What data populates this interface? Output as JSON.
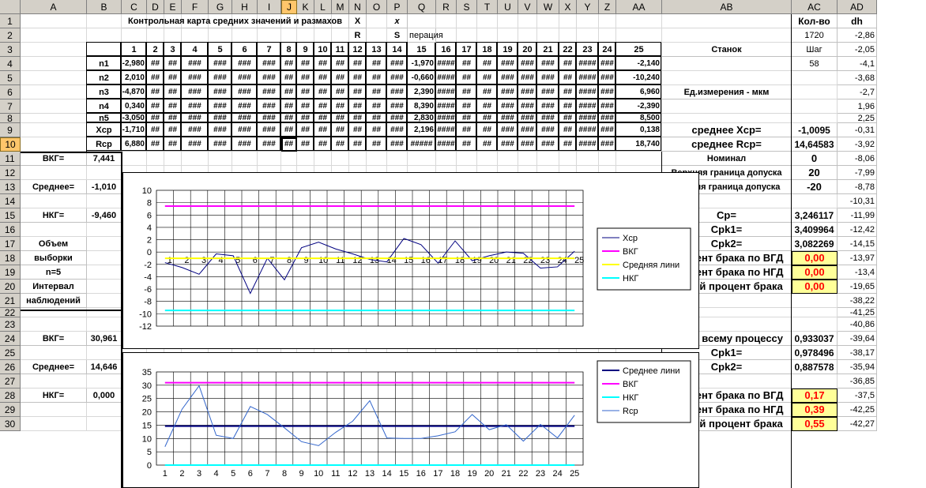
{
  "columns": [
    "A",
    "B",
    "C",
    "D",
    "E",
    "F",
    "G",
    "H",
    "I",
    "J",
    "K",
    "L",
    "M",
    "N",
    "O",
    "P",
    "Q",
    "R",
    "S",
    "T",
    "U",
    "V",
    "W",
    "X",
    "Y",
    "Z",
    "AA",
    "AB",
    "AC",
    "AD"
  ],
  "selected_column": "J",
  "rows": [
    "1",
    "2",
    "3",
    "4",
    "5",
    "6",
    "7",
    "8",
    "9",
    "10",
    "11",
    "12",
    "13",
    "14",
    "15",
    "16",
    "17",
    "18",
    "19",
    "20",
    "21",
    "22",
    "23",
    "24",
    "25",
    "26",
    "27",
    "28",
    "29",
    "30"
  ],
  "selected_row": "10",
  "title": "Контрольная карта средних значений и размахов",
  "n1": "X",
  "n2": "R",
  "p1": "x",
  "p2": "S",
  "q2": "перация",
  "ac1": "Кол-во",
  "ad1": "dh",
  "ac2": "1720",
  "ad2": "-2,86",
  "ab3": "Станок",
  "ac3": "Шаг",
  "ad3": "-2,05",
  "ac4": "58",
  "ad4": "-4,1",
  "ab6": "Ед.измерения - мкм",
  "ad_col": [
    "",
    "",
    "",
    "",
    "-3,68",
    "-2,7",
    "1,96",
    "2,25",
    "-0,31",
    "-3,92",
    "-8,06",
    "-7,99",
    "-8,78",
    "-10,31",
    "-11,99",
    "-12,42",
    "-14,15",
    "-13,97",
    "-13,4",
    "-19,65",
    "-38,22",
    "-41,25",
    "-40,86",
    "-39,64",
    "-38,17",
    "-35,94",
    "-36,85",
    "-37,5",
    "-42,25",
    "-42,27"
  ],
  "col_numbers": [
    "1",
    "2",
    "3",
    "4",
    "5",
    "6",
    "7",
    "8",
    "9",
    "10",
    "11",
    "12",
    "13",
    "14",
    "15",
    "16",
    "17",
    "18",
    "19",
    "20",
    "21",
    "22",
    "23",
    "24",
    "25"
  ],
  "row_labels": [
    "n1",
    "n2",
    "n3",
    "n4",
    "n5",
    "Xср",
    "Rср"
  ],
  "table": [
    [
      "-2,980",
      "##",
      "##",
      "###",
      "###",
      "###",
      "###",
      "##",
      "##",
      "##",
      "##",
      "##",
      "##",
      "###",
      "-1,970",
      "####",
      "##",
      "##",
      "###",
      "###",
      "###",
      "##",
      "####",
      "###",
      "-2,140"
    ],
    [
      "2,010",
      "##",
      "##",
      "###",
      "###",
      "###",
      "###",
      "##",
      "##",
      "##",
      "##",
      "##",
      "##",
      "###",
      "-0,660",
      "####",
      "##",
      "##",
      "###",
      "###",
      "###",
      "##",
      "####",
      "###",
      "-10,240"
    ],
    [
      "-4,870",
      "##",
      "##",
      "###",
      "###",
      "###",
      "###",
      "##",
      "##",
      "##",
      "##",
      "##",
      "##",
      "###",
      "2,390",
      "####",
      "##",
      "##",
      "###",
      "###",
      "###",
      "##",
      "####",
      "###",
      "6,960"
    ],
    [
      "0,340",
      "##",
      "##",
      "###",
      "###",
      "###",
      "###",
      "##",
      "##",
      "##",
      "##",
      "##",
      "##",
      "###",
      "8,390",
      "####",
      "##",
      "##",
      "###",
      "###",
      "###",
      "##",
      "####",
      "###",
      "-2,390"
    ],
    [
      "-3,050",
      "##",
      "##",
      "###",
      "###",
      "###",
      "###",
      "##",
      "##",
      "##",
      "##",
      "##",
      "##",
      "###",
      "2,830",
      "####",
      "##",
      "##",
      "###",
      "###",
      "###",
      "##",
      "####",
      "###",
      "8,500"
    ],
    [
      "-1,710",
      "##",
      "##",
      "###",
      "###",
      "###",
      "###",
      "##",
      "##",
      "##",
      "##",
      "##",
      "##",
      "###",
      "2,196",
      "####",
      "##",
      "##",
      "###",
      "###",
      "###",
      "##",
      "####",
      "###",
      "0,138"
    ],
    [
      "6,880",
      "##",
      "##",
      "###",
      "###",
      "###",
      "###",
      "##",
      "##",
      "##",
      "##",
      "##",
      "##",
      "###",
      "#####",
      "####",
      "##",
      "##",
      "###",
      "###",
      "###",
      "##",
      "####",
      "###",
      "18,740"
    ]
  ],
  "ab9": "среднее Xср=",
  "ac9": "-1,0095",
  "ab10": "среднее Rср=",
  "ac10": "14,64583",
  "ab11": "Номинал",
  "ac11": "0",
  "ab12": "Верхняя граница допуска",
  "ac12": "20",
  "ab13": "Нижняя граница допуска",
  "ac13": "-20",
  "ab15": "Cp=",
  "ac15": "3,246117",
  "ab16": "Cpk1=",
  "ac16": "3,409964",
  "ab17": "Cpk2=",
  "ac17": "3,082269",
  "ab18": "Процент брака по ВГД",
  "ac18": "0,00",
  "ab19": "Процент брака по НГД",
  "ac19": "0,00",
  "ab20": "Общий процент брака",
  "ac20": "0,00",
  "ab24": "Cp по всему процессу",
  "ac24": "0,933037",
  "ab25": "Cpk1=",
  "ac25": "0,978496",
  "ab26": "Cpk2=",
  "ac26": "0,887578",
  "ab28": "Процент брака по ВГД",
  "ac28": "0,17",
  "ab29": "Процент брака по НГД",
  "ac29": "0,39",
  "ab30": "Общий процент брака",
  "ac30": "0,55",
  "a11": "ВКГ=",
  "b11": "7,441",
  "a13": "Среднее=",
  "b13": "-1,010",
  "a15": "НКГ=",
  "b15": "-9,460",
  "a17": "Объем",
  "a18": "выборки",
  "a19": "n=5",
  "a20": "Интервал",
  "a21": "наблюдений",
  "a24": "ВКГ=",
  "b24": "30,961",
  "a26": "Среднее=",
  "b26": "14,646",
  "a28": "НКГ=",
  "b28": "0,000",
  "colors": {
    "vkg": "#ff00ff",
    "avg": "#ffff00",
    "nkg": "#00ffff",
    "xcp": "#000080",
    "rcp": "#3366cc",
    "avg2": "#000080",
    "highlight": "#ffff99",
    "red": "#ff0000"
  },
  "chart_data": [
    {
      "type": "line",
      "x": [
        1,
        2,
        3,
        4,
        5,
        6,
        7,
        8,
        9,
        10,
        11,
        12,
        13,
        14,
        15,
        16,
        17,
        18,
        19,
        20,
        21,
        22,
        23,
        24,
        25
      ],
      "ylim": [
        -12,
        10
      ],
      "yticks": [
        -12,
        -10,
        -8,
        -6,
        -4,
        -2,
        0,
        2,
        4,
        6,
        8,
        10
      ],
      "series": [
        {
          "name": "Xср",
          "values": [
            -1.71,
            -2.5,
            -3.6,
            -0.3,
            -0.6,
            -6.7,
            -1.0,
            -4.5,
            0.7,
            1.6,
            0.5,
            -0.3,
            -1.2,
            -1.6,
            2.2,
            1.2,
            -1.8,
            1.8,
            -1.4,
            -0.6,
            0.0,
            -0.2,
            -2.6,
            -2.4,
            0.14
          ]
        },
        {
          "name": "ВКГ",
          "values": [
            7.441,
            7.441,
            7.441,
            7.441,
            7.441,
            7.441,
            7.441,
            7.441,
            7.441,
            7.441,
            7.441,
            7.441,
            7.441,
            7.441,
            7.441,
            7.441,
            7.441,
            7.441,
            7.441,
            7.441,
            7.441,
            7.441,
            7.441,
            7.441,
            7.441
          ]
        },
        {
          "name": "Средняя лини",
          "values": [
            -1.01,
            -1.01,
            -1.01,
            -1.01,
            -1.01,
            -1.01,
            -1.01,
            -1.01,
            -1.01,
            -1.01,
            -1.01,
            -1.01,
            -1.01,
            -1.01,
            -1.01,
            -1.01,
            -1.01,
            -1.01,
            -1.01,
            -1.01,
            -1.01,
            -1.01,
            -1.01,
            -1.01,
            -1.01
          ]
        },
        {
          "name": "НКГ",
          "values": [
            -9.46,
            -9.46,
            -9.46,
            -9.46,
            -9.46,
            -9.46,
            -9.46,
            -9.46,
            -9.46,
            -9.46,
            -9.46,
            -9.46,
            -9.46,
            -9.46,
            -9.46,
            -9.46,
            -9.46,
            -9.46,
            -9.46,
            -9.46,
            -9.46,
            -9.46,
            -9.46,
            -9.46,
            -9.46
          ]
        }
      ],
      "legend": "right",
      "grid": true
    },
    {
      "type": "line",
      "x": [
        1,
        2,
        3,
        4,
        5,
        6,
        7,
        8,
        9,
        10,
        11,
        12,
        13,
        14,
        15,
        16,
        17,
        18,
        19,
        20,
        21,
        22,
        23,
        24,
        25
      ],
      "ylim": [
        0,
        35
      ],
      "yticks": [
        0,
        5,
        10,
        15,
        20,
        25,
        30,
        35
      ],
      "series": [
        {
          "name": "Среднее лини",
          "values": [
            14.646,
            14.646,
            14.646,
            14.646,
            14.646,
            14.646,
            14.646,
            14.646,
            14.646,
            14.646,
            14.646,
            14.646,
            14.646,
            14.646,
            14.646,
            14.646,
            14.646,
            14.646,
            14.646,
            14.646,
            14.646,
            14.646,
            14.646,
            14.646,
            14.646
          ]
        },
        {
          "name": "ВКГ",
          "values": [
            30.961,
            30.961,
            30.961,
            30.961,
            30.961,
            30.961,
            30.961,
            30.961,
            30.961,
            30.961,
            30.961,
            30.961,
            30.961,
            30.961,
            30.961,
            30.961,
            30.961,
            30.961,
            30.961,
            30.961,
            30.961,
            30.961,
            30.961,
            30.961,
            30.961
          ]
        },
        {
          "name": "НКГ",
          "values": [
            0,
            0,
            0,
            0,
            0,
            0,
            0,
            0,
            0,
            0,
            0,
            0,
            0,
            0,
            0,
            0,
            0,
            0,
            0,
            0,
            0,
            0,
            0,
            0,
            0
          ]
        },
        {
          "name": "Rср",
          "values": [
            6.9,
            21.0,
            29.8,
            11.2,
            10.0,
            22.0,
            19.0,
            14.0,
            8.8,
            7.3,
            12.3,
            16.5,
            24.2,
            10.2,
            10.0,
            10.0,
            11.0,
            12.5,
            19.0,
            13.3,
            15.2,
            9.0,
            15.3,
            10.2,
            18.74
          ]
        }
      ],
      "legend": "right",
      "grid": true
    }
  ]
}
